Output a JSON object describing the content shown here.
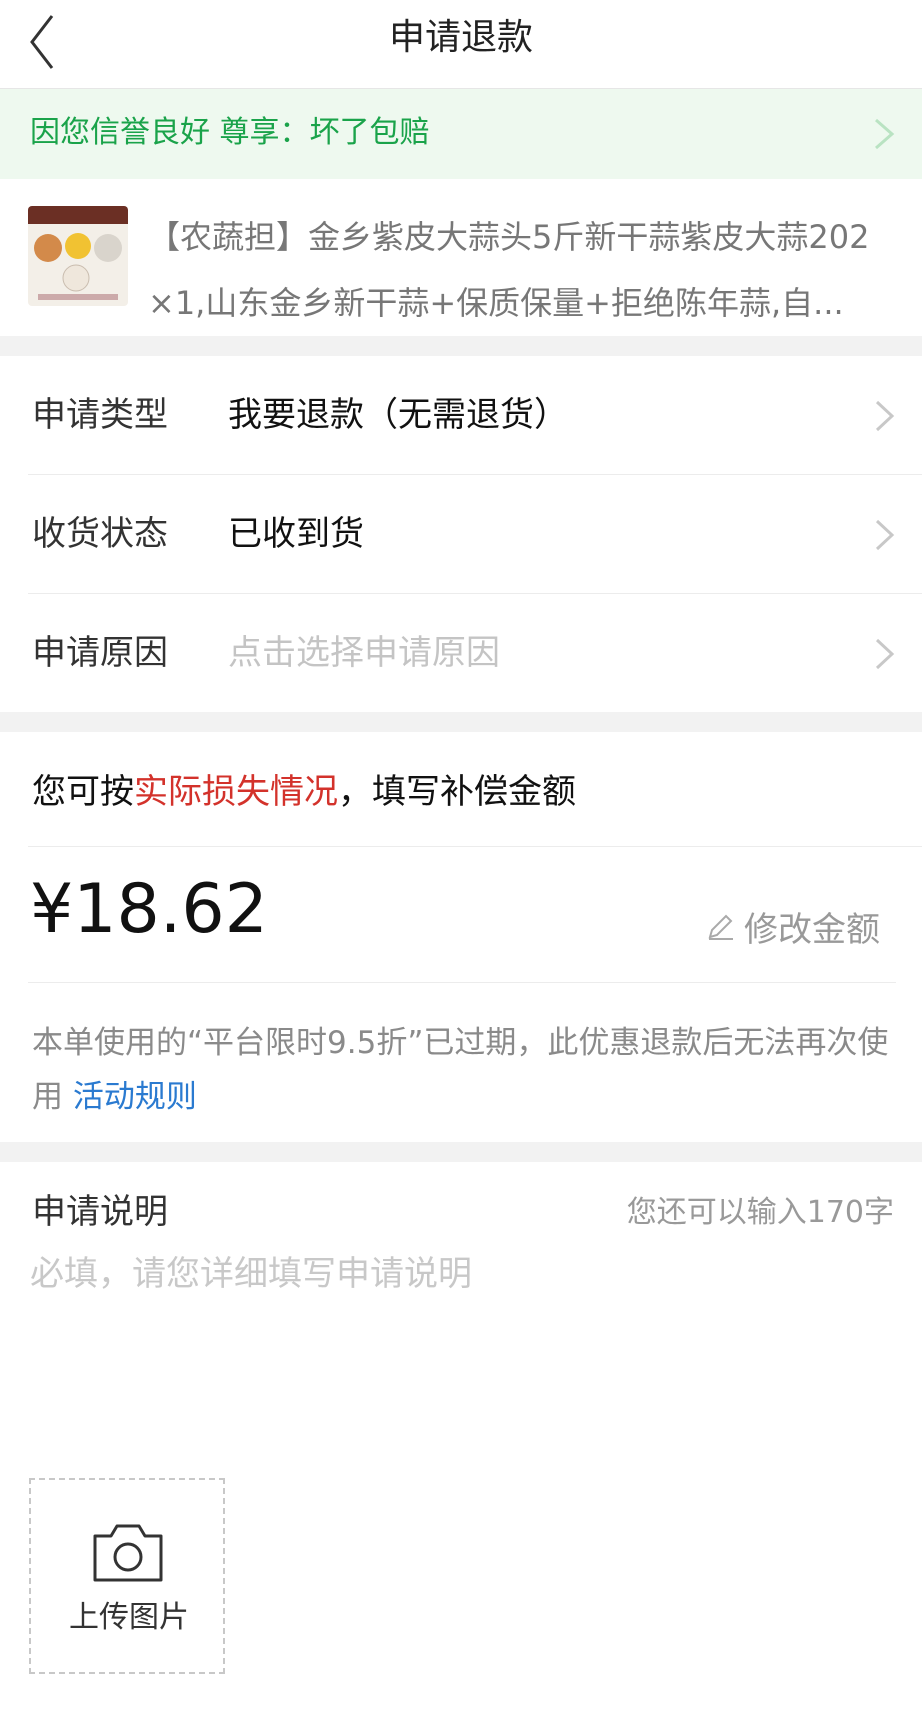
{
  "header": {
    "title": "申请退款",
    "back_icon": "chevron-left-icon"
  },
  "promo": {
    "text": "因您信誉良好 尊享：坏了包赔",
    "color": "#1aa34a",
    "bg": "#eef9ef"
  },
  "product": {
    "title_line1": "【农蔬担】金乡紫皮大蒜头5斤新干蒜紫皮大蒜202",
    "title_line2": "×1,山东金乡新干蒜+保质保量+拒绝陈年蒜,自...",
    "thumb_banner": "农蔬担 蒜质有标准"
  },
  "form": {
    "rows": [
      {
        "label": "申请类型",
        "value": "我要退款（无需退货）",
        "placeholder": false
      },
      {
        "label": "收货状态",
        "value": "已收到货",
        "placeholder": false
      },
      {
        "label": "申请原因",
        "value": "点击选择申请原因",
        "placeholder": true
      }
    ]
  },
  "compensation": {
    "hint_prefix": "您可按",
    "hint_highlight": "实际损失情况",
    "hint_suffix": "，填写补偿金额",
    "amount": "¥18.62",
    "edit_label": "修改金额",
    "coupon_notice": "本单使用的“平台限时9.5折”已过期，此优惠退款后无法再次使用",
    "coupon_link": "活动规则",
    "highlight_color": "#d3322b",
    "link_color": "#2a7ad0"
  },
  "description": {
    "label": "申请说明",
    "counter": "您还可以输入170字",
    "placeholder": "必填，请您详细填写申请说明"
  },
  "upload": {
    "label": "上传图片",
    "icon": "camera-icon"
  }
}
